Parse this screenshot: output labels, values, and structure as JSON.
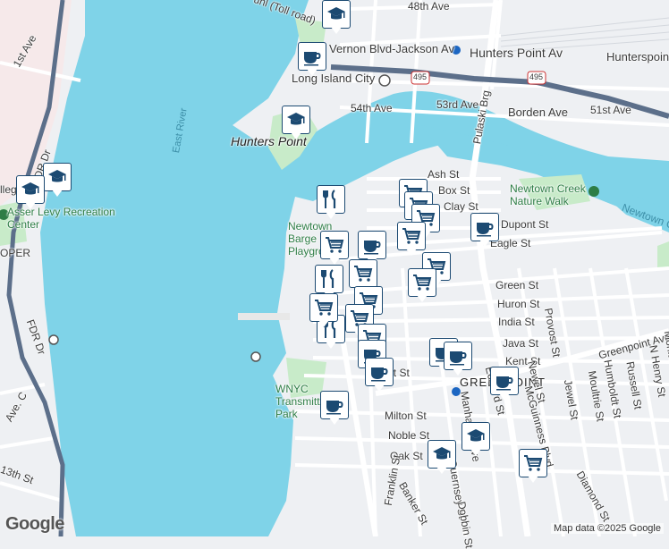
{
  "map": {
    "attribution": "Map data ©2025 Google",
    "logo": "Google",
    "colors": {
      "water": "#7fd3e8",
      "land": "#eef0f3",
      "park": "#c8ebc9",
      "highway": "#5c6f8a",
      "road": "#ffffff",
      "pin_border": "#1c4a72"
    }
  },
  "places": {
    "hunters_point": "Hunters Point",
    "greenpoint": "GREENPOINT",
    "lic": "Long Island City",
    "vernon": "Vernon Blvd-Jackson Av",
    "hunters_point_av": "Hunters Point Av",
    "hunterspoint_right": "Hunterspoint",
    "recreation": "Asser Levy Recreation Center",
    "asser_short": "As",
    "college": "llege",
    "cooper": "OPER",
    "newtown_creek": "Newtown Creek Nature Walk",
    "newtown_creek_water": "Newtown C",
    "newtown_barge": "Newtown Barge Playground",
    "wnyc": "WNYC Transmitter Park",
    "east_river": "East River",
    "toll_road": "unl (Toll road)",
    "pulaski": "Pulaski Brg",
    "hwy_495": "495"
  },
  "streets": [
    "48th Ave",
    "1st Ave",
    "54th Ave",
    "53rd Ave",
    "Borden Ave",
    "51st Ave",
    "FDR Dr",
    "Ash St",
    "Box St",
    "Clay St",
    "Dupont St",
    "Eagle St",
    "Green St",
    "Huron St",
    "India St",
    "Java St",
    "Kent St",
    "Greenpoint Ave",
    "Milton St",
    "Noble St",
    "Oak St",
    "Franklin St",
    "Banker St",
    "Guernsey St",
    "Dobbin St",
    "Manhattan Ave",
    "Eckford St",
    "McGuinness Blvd",
    "Newel St",
    "Provost St",
    "Jewel St",
    "Moultrie St",
    "Humboldt St",
    "Russell St",
    "N Henry St",
    "Monitor St",
    "Diamond St",
    "Ave. C",
    "13th St",
    "West St"
  ],
  "pins": [
    {
      "type": "school"
    },
    {
      "type": "cafe"
    },
    {
      "type": "school"
    },
    {
      "type": "school"
    },
    {
      "type": "school"
    },
    {
      "type": "restaurant"
    },
    {
      "type": "shopping"
    },
    {
      "type": "shopping"
    },
    {
      "type": "shopping"
    },
    {
      "type": "cafe"
    },
    {
      "type": "shopping"
    },
    {
      "type": "cafe"
    },
    {
      "type": "shopping"
    },
    {
      "type": "restaurant"
    },
    {
      "type": "shopping"
    },
    {
      "type": "shopping"
    },
    {
      "type": "shopping"
    },
    {
      "type": "shopping"
    },
    {
      "type": "restaurant"
    },
    {
      "type": "shopping"
    },
    {
      "type": "shopping"
    },
    {
      "type": "shopping"
    },
    {
      "type": "cafe"
    },
    {
      "type": "cafe"
    },
    {
      "type": "cafe"
    },
    {
      "type": "cafe"
    },
    {
      "type": "cafe"
    },
    {
      "type": "cafe"
    },
    {
      "type": "school"
    },
    {
      "type": "school"
    },
    {
      "type": "shopping"
    }
  ]
}
